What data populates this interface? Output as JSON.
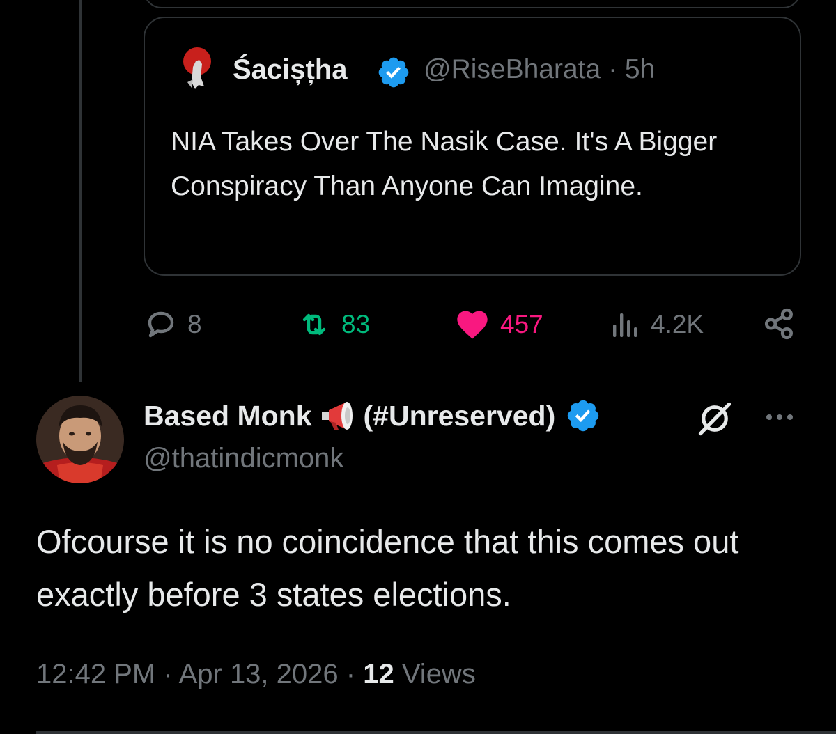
{
  "quoted_tweet": {
    "display_name": "Śacișțha",
    "handle": "@RiseBharata",
    "separator": "·",
    "time_ago": "5h",
    "text": "NIA Takes Over The Nasik Case. It's A Bigger Conspiracy Than Anyone Can Imagine.",
    "avatar_icon": "profile-avatar",
    "verified_icon": "verified-badge-icon"
  },
  "actions": {
    "replies": "8",
    "retweets": "83",
    "likes": "457",
    "views": "4.2K"
  },
  "tweet": {
    "display_name": "Based Monk",
    "name_emoji_icon": "megaphone-icon",
    "name_tag": "(#Unreserved)",
    "handle": "@thatindicmonk",
    "text": "Ofcourse it is no coincidence that this comes out exactly before 3 states elections.",
    "time": "12:42 PM",
    "separator": "·",
    "date": "Apr 13, 2026",
    "views_count": "12",
    "views_label": "Views"
  },
  "colors": {
    "background": "#000000",
    "text_primary": "#e7e9ea",
    "text_secondary": "#71767b",
    "border": "#2f3336",
    "verified_blue": "#1d9bf0",
    "retweet_green": "#00ba7c",
    "like_pink": "#f91880"
  }
}
